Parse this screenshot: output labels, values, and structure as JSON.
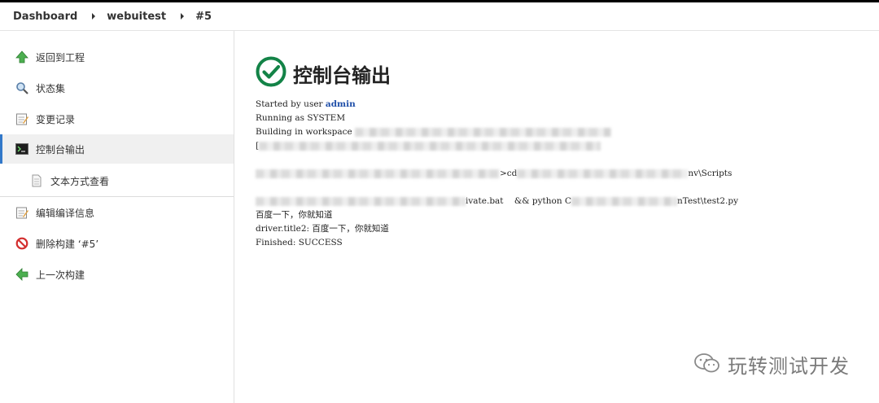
{
  "breadcrumb": {
    "items": [
      "Dashboard",
      "webuitest",
      "#5"
    ]
  },
  "sidebar": {
    "items": [
      {
        "label": "返回到工程",
        "icon": "up-arrow-icon"
      },
      {
        "label": "状态集",
        "icon": "search-icon"
      },
      {
        "label": "变更记录",
        "icon": "notepad-icon"
      },
      {
        "label": "控制台输出",
        "icon": "terminal-icon",
        "active": true
      },
      {
        "label": "文本方式查看",
        "icon": "document-icon"
      },
      {
        "label": "编辑编译信息",
        "icon": "notepad-icon"
      },
      {
        "label": "删除构建 ‘#5’",
        "icon": "no-entry-icon"
      },
      {
        "label": "上一次构建",
        "icon": "left-arrow-icon"
      }
    ]
  },
  "main": {
    "title": "控制台输出",
    "status_icon": "success-check-icon",
    "status_color": "#138347"
  },
  "console": {
    "started_prefix": "Started by user ",
    "started_user": "admin",
    "running_as": "Running as SYSTEM",
    "building_prefix": "Building in workspace ",
    "line4_prefix": "[",
    "line6_mid": ">cd",
    "line6_tail": "nv\\Scripts",
    "line8_mid": "ivate.bat    && python C",
    "line8_tail": "nTest\\test2.py",
    "output1": "百度一下，你就知道",
    "output2": "driver.title2: 百度一下，你就知道",
    "finished": "Finished: SUCCESS"
  },
  "watermark": {
    "text": "玩转测试开发",
    "icon": "wechat-icon"
  },
  "colors": {
    "accent": "#3278c9",
    "link": "#1e4ea8",
    "success": "#138347"
  }
}
